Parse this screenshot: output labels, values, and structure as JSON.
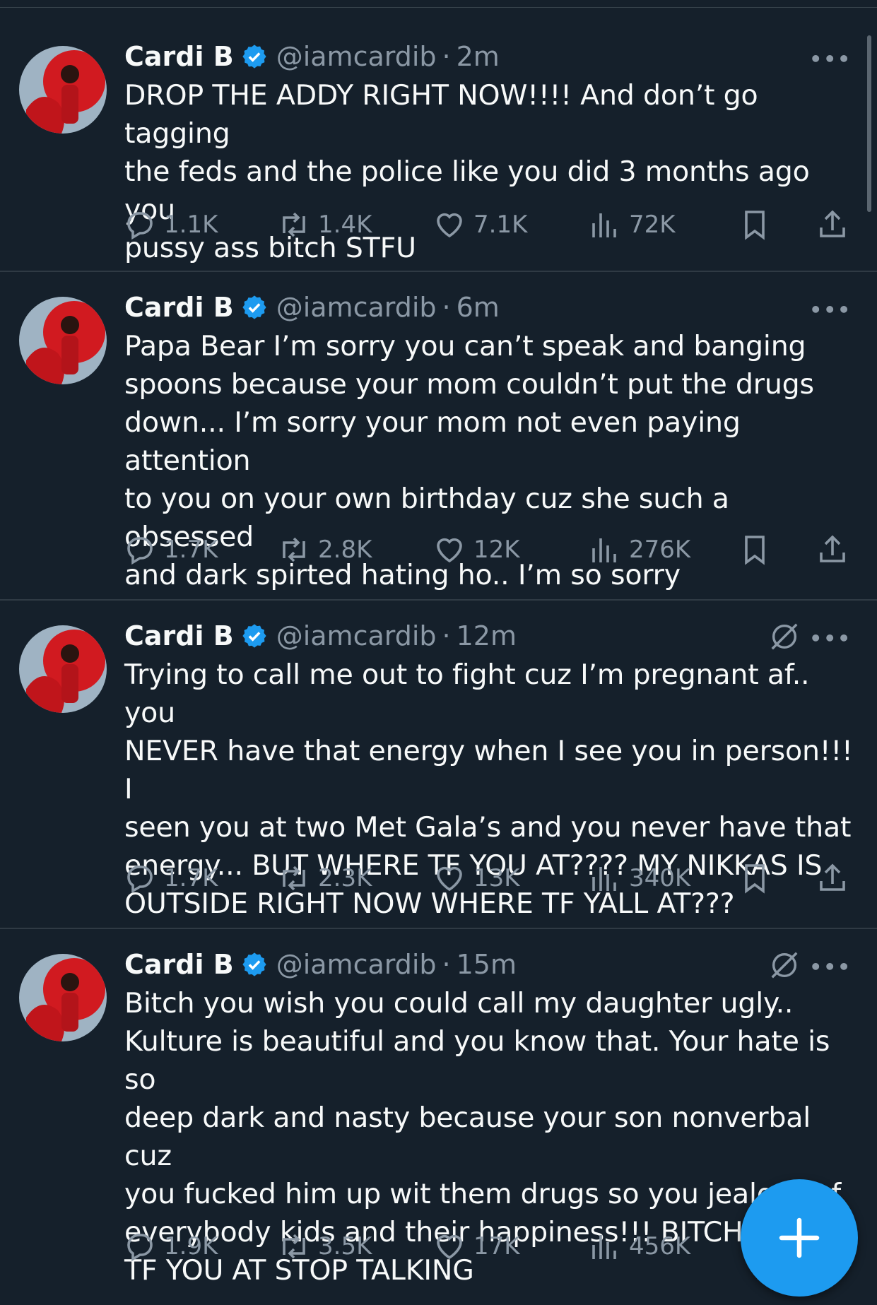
{
  "colors": {
    "background": "#15202b",
    "accent": "#1d9bf0",
    "secondary_text": "#8b98a5",
    "primary_text": "#f7f9f9"
  },
  "icons": {
    "reply": "reply-icon",
    "retweet": "retweet-icon",
    "like": "like-icon",
    "views": "views-icon",
    "bookmark": "bookmark-icon",
    "share": "share-icon",
    "more": "more-icon",
    "verified": "verified-badge-icon",
    "muted": "muted-conversation-icon",
    "compose": "plus-icon"
  },
  "tweets": [
    {
      "name": "Cardi B",
      "handle": "@iamcardib",
      "time": "2m",
      "text": "DROP THE ADDY RIGHT NOW!!!! And don’t go tagging\nthe feds and the police like you did 3 months ago you\npussy ass bitch STFU",
      "replies": "1.1K",
      "retweets": "1.4K",
      "likes": "7.1K",
      "views": "72K"
    },
    {
      "name": "Cardi B",
      "handle": "@iamcardib",
      "time": "6m",
      "text": "Papa Bear I’m sorry you can’t speak and banging\nspoons because your mom couldn’t put the drugs\ndown... I’m sorry your mom not even paying attention\nto you on your own birthday cuz she such a obsessed\nand dark spirted hating ho.. I’m so sorry",
      "replies": "1.7K",
      "retweets": "2.8K",
      "likes": "12K",
      "views": "276K"
    },
    {
      "name": "Cardi B",
      "handle": "@iamcardib",
      "time": "12m",
      "text": "Trying to call me out to fight cuz I’m pregnant af.. you\nNEVER have that energy when I see you in person!!! I\nseen you at two Met Gala’s and you never have that\nenergy... BUT WHERE TF YOU AT???? MY NIKKAS IS\nOUTSIDE RIGHT NOW WHERE TF YALL AT???",
      "replies": "1.7K",
      "retweets": "2.3K",
      "likes": "13K",
      "views": "340K"
    },
    {
      "name": "Cardi B",
      "handle": "@iamcardib",
      "time": "15m",
      "text": "Bitch you wish you could call my daughter ugly..\nKulture is beautiful and you know that. Your hate is so\ndeep dark and nasty because your son nonverbal cuz\nyou fucked him up wit them drugs so you jealous of\neverybody kids and their happiness!!! BITCH WHERE\nTF YOU AT STOP TALKING",
      "replies": "1.9K",
      "retweets": "3.5K",
      "likes": "17K",
      "views": "456K"
    }
  ],
  "separator": "·"
}
